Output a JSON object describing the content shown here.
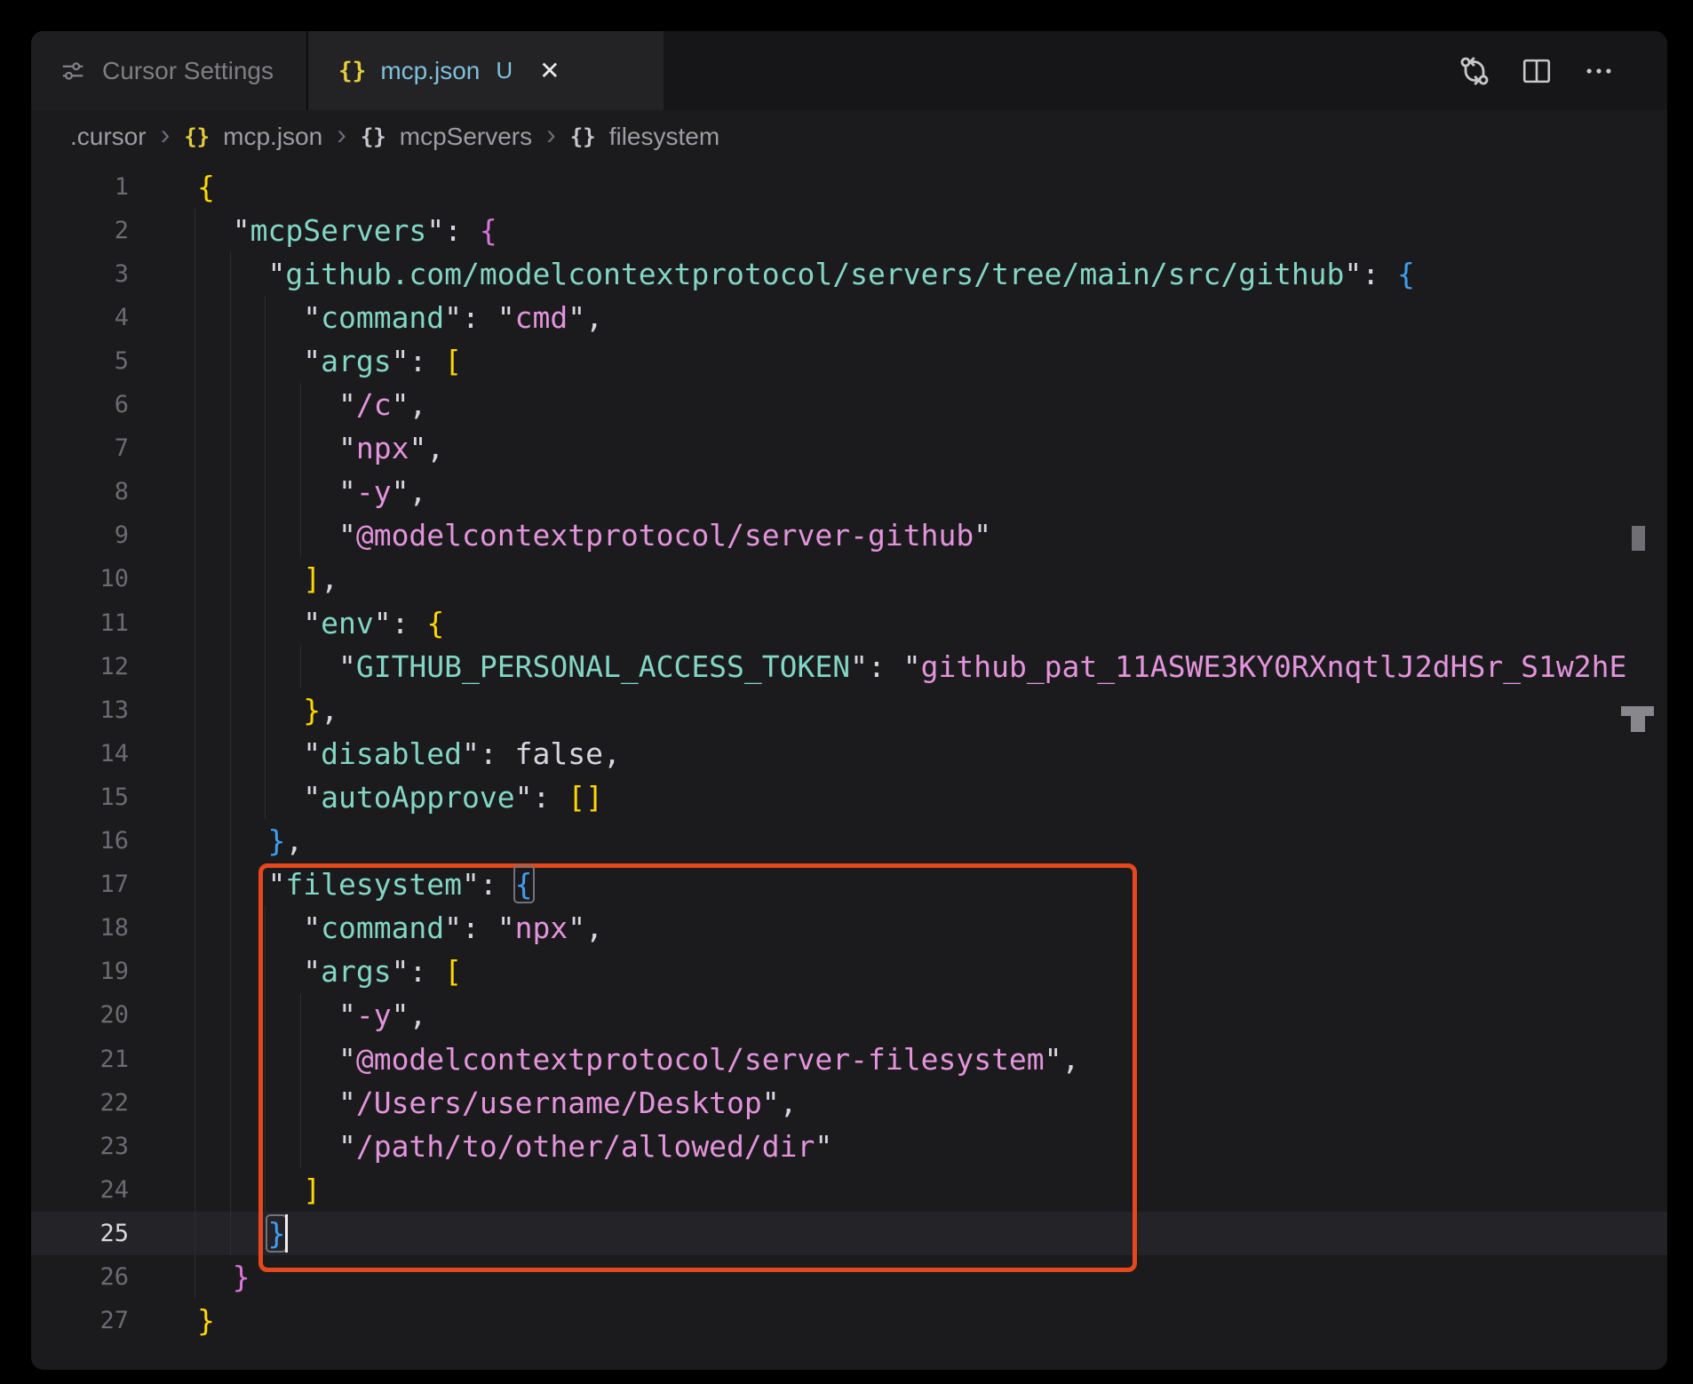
{
  "window": {
    "tabs": [
      {
        "label": "Cursor Settings",
        "icon": "sliders-icon",
        "state": "inactive"
      },
      {
        "label": "mcp.json",
        "icon": "json-braces-icon",
        "modified_badge": "U",
        "close_glyph": "✕",
        "state": "active"
      }
    ],
    "actions": [
      "open-changes-icon",
      "split-editor-icon",
      "more-actions-icon"
    ]
  },
  "breadcrumb": {
    "chevron_glyph": "›",
    "brace_glyph": "{}",
    "items": [
      ".cursor",
      "mcp.json",
      "mcpServers",
      "filesystem"
    ]
  },
  "editor": {
    "language": "json",
    "current_line": 25,
    "colors": {
      "editor_bg": "#1b1b1d",
      "key": "#83d6c5",
      "string": "#e394dc",
      "punctuation": "#d6d6dd",
      "bracket_level1": "#ffd602",
      "bracket_level2": "#d977d9",
      "bracket_level3": "#3f9ef2",
      "annotation_box": "#e5481d",
      "active_tab_filename": "#7fc0da"
    },
    "lines": [
      {
        "num": 1,
        "tokens": [
          [
            "b1",
            "{"
          ]
        ]
      },
      {
        "num": 2,
        "tokens": [
          [
            "t",
            "  "
          ],
          [
            "p",
            "\""
          ],
          [
            "k",
            "mcpServers"
          ],
          [
            "p",
            "\": "
          ],
          [
            "b2",
            "{"
          ]
        ]
      },
      {
        "num": 3,
        "tokens": [
          [
            "t",
            "    "
          ],
          [
            "p",
            "\""
          ],
          [
            "k",
            "github.com/modelcontextprotocol/servers/tree/main/src/github"
          ],
          [
            "p",
            "\": "
          ],
          [
            "b3",
            "{"
          ]
        ]
      },
      {
        "num": 4,
        "tokens": [
          [
            "t",
            "      "
          ],
          [
            "p",
            "\""
          ],
          [
            "k",
            "command"
          ],
          [
            "p",
            "\": \""
          ],
          [
            "s",
            "cmd"
          ],
          [
            "p",
            "\","
          ]
        ]
      },
      {
        "num": 5,
        "tokens": [
          [
            "t",
            "      "
          ],
          [
            "p",
            "\""
          ],
          [
            "k",
            "args"
          ],
          [
            "p",
            "\": "
          ],
          [
            "b1",
            "["
          ]
        ]
      },
      {
        "num": 6,
        "tokens": [
          [
            "t",
            "        "
          ],
          [
            "p",
            "\""
          ],
          [
            "s",
            "/c"
          ],
          [
            "p",
            "\","
          ]
        ]
      },
      {
        "num": 7,
        "tokens": [
          [
            "t",
            "        "
          ],
          [
            "p",
            "\""
          ],
          [
            "s",
            "npx"
          ],
          [
            "p",
            "\","
          ]
        ]
      },
      {
        "num": 8,
        "tokens": [
          [
            "t",
            "        "
          ],
          [
            "p",
            "\""
          ],
          [
            "s",
            "-y"
          ],
          [
            "p",
            "\","
          ]
        ]
      },
      {
        "num": 9,
        "tokens": [
          [
            "t",
            "        "
          ],
          [
            "p",
            "\""
          ],
          [
            "s",
            "@modelcontextprotocol/server-github"
          ],
          [
            "p",
            "\""
          ]
        ]
      },
      {
        "num": 10,
        "tokens": [
          [
            "t",
            "      "
          ],
          [
            "b1",
            "]"
          ],
          [
            "p",
            ","
          ]
        ]
      },
      {
        "num": 11,
        "tokens": [
          [
            "t",
            "      "
          ],
          [
            "p",
            "\""
          ],
          [
            "k",
            "env"
          ],
          [
            "p",
            "\": "
          ],
          [
            "b1",
            "{"
          ]
        ]
      },
      {
        "num": 12,
        "tokens": [
          [
            "t",
            "        "
          ],
          [
            "p",
            "\""
          ],
          [
            "k",
            "GITHUB_PERSONAL_ACCESS_TOKEN"
          ],
          [
            "p",
            "\": \""
          ],
          [
            "s",
            "github_pat_11ASWE3KY0RXnqtlJ2dHSr_S1w2hE"
          ]
        ]
      },
      {
        "num": 13,
        "tokens": [
          [
            "t",
            "      "
          ],
          [
            "b1",
            "}"
          ],
          [
            "p",
            ","
          ]
        ]
      },
      {
        "num": 14,
        "tokens": [
          [
            "t",
            "      "
          ],
          [
            "p",
            "\""
          ],
          [
            "k",
            "disabled"
          ],
          [
            "p",
            "\": "
          ],
          [
            "v",
            "false"
          ],
          [
            "p",
            ","
          ]
        ]
      },
      {
        "num": 15,
        "tokens": [
          [
            "t",
            "      "
          ],
          [
            "p",
            "\""
          ],
          [
            "k",
            "autoApprove"
          ],
          [
            "p",
            "\": "
          ],
          [
            "b1",
            "[]"
          ]
        ]
      },
      {
        "num": 16,
        "tokens": [
          [
            "t",
            "    "
          ],
          [
            "b3",
            "}"
          ],
          [
            "p",
            ","
          ]
        ]
      },
      {
        "num": 17,
        "tokens": [
          [
            "t",
            "    "
          ],
          [
            "p",
            "\""
          ],
          [
            "k",
            "filesystem"
          ],
          [
            "p",
            "\": "
          ],
          [
            "b3 m",
            "{"
          ]
        ]
      },
      {
        "num": 18,
        "tokens": [
          [
            "t",
            "      "
          ],
          [
            "p",
            "\""
          ],
          [
            "k",
            "command"
          ],
          [
            "p",
            "\": \""
          ],
          [
            "s",
            "npx"
          ],
          [
            "p",
            "\","
          ]
        ]
      },
      {
        "num": 19,
        "tokens": [
          [
            "t",
            "      "
          ],
          [
            "p",
            "\""
          ],
          [
            "k",
            "args"
          ],
          [
            "p",
            "\": "
          ],
          [
            "b1",
            "["
          ]
        ]
      },
      {
        "num": 20,
        "tokens": [
          [
            "t",
            "        "
          ],
          [
            "p",
            "\""
          ],
          [
            "s",
            "-y"
          ],
          [
            "p",
            "\","
          ]
        ]
      },
      {
        "num": 21,
        "tokens": [
          [
            "t",
            "        "
          ],
          [
            "p",
            "\""
          ],
          [
            "s",
            "@modelcontextprotocol/server-filesystem"
          ],
          [
            "p",
            "\","
          ]
        ]
      },
      {
        "num": 22,
        "tokens": [
          [
            "t",
            "        "
          ],
          [
            "p",
            "\""
          ],
          [
            "s",
            "/Users/username/Desktop"
          ],
          [
            "p",
            "\","
          ]
        ]
      },
      {
        "num": 23,
        "tokens": [
          [
            "t",
            "        "
          ],
          [
            "p",
            "\""
          ],
          [
            "s",
            "/path/to/other/allowed/dir"
          ],
          [
            "p",
            "\""
          ]
        ]
      },
      {
        "num": 24,
        "tokens": [
          [
            "t",
            "      "
          ],
          [
            "b1",
            "]"
          ]
        ]
      },
      {
        "num": 25,
        "tokens": [
          [
            "t",
            "    "
          ],
          [
            "b3 m",
            "}"
          ]
        ]
      },
      {
        "num": 26,
        "tokens": [
          [
            "t",
            "  "
          ],
          [
            "b2",
            "}"
          ]
        ]
      },
      {
        "num": 27,
        "tokens": [
          [
            "b1",
            "}"
          ]
        ]
      }
    ]
  }
}
